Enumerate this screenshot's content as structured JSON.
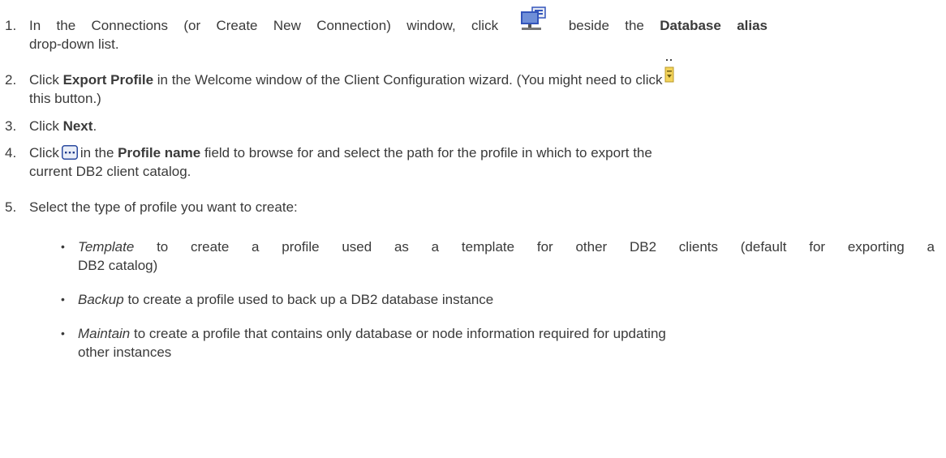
{
  "steps": [
    {
      "num": "1.",
      "t1": "In the Connections (or Create New Connection) window, click",
      "t2": "beside the",
      "b1": "Database alias",
      "t3": "drop-down  list."
    },
    {
      "num": "2.",
      "t1": "Click",
      "b1": "Export Profile",
      "t2": "in the Welcome window of the Client Configuration wizard. (You might need to click",
      "t3": "this button.)"
    },
    {
      "num": "3.",
      "t1": "Click",
      "b1": "Next",
      "t2": "."
    },
    {
      "num": "4.",
      "t1": "Click",
      "t2": "in the",
      "b1": "Profile name",
      "t3": "field to browse for and select the path for the profile in which to export the",
      "t4": "current DB2 client catalog."
    },
    {
      "num": "5.",
      "t1": "Select the type of profile you want to create:"
    }
  ],
  "bullets": [
    {
      "term": "Template",
      "l1": "to create a profile used as a template for other DB2 clients (default for exporting a",
      "l2": "DB2 catalog)"
    },
    {
      "term": "Backup",
      "l1": "to create a profile used to back up a DB2 database instance"
    },
    {
      "term": "Maintain",
      "l1": "to create a profile that contains only database or node information required for updating",
      "l2": "other instances"
    }
  ],
  "icons": {
    "connection": "connection-computer-icon",
    "scroll": "scroll-down-icon",
    "browse": "browse-ellipsis-icon"
  },
  "colors": {
    "text": "#3a3a3a",
    "icon_blue": "#3355bb",
    "icon_screen": "#6f8fd8"
  }
}
